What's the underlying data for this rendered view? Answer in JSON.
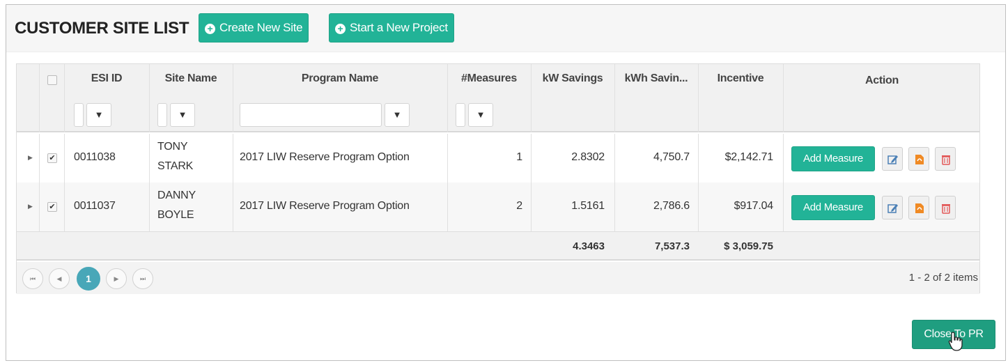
{
  "header": {
    "title": "CUSTOMER SITE LIST",
    "create_site_label": "Create New Site",
    "start_project_label": "Start a New Project"
  },
  "grid": {
    "columns": {
      "esi_id": "ESI ID",
      "site_name": "Site Name",
      "program_name": "Program Name",
      "measures": "#Measures",
      "kw_savings": "kW Savings",
      "kwh_savings": "kWh Savin...",
      "incentive": "Incentive",
      "action": "Action"
    },
    "rows": [
      {
        "checked": true,
        "esi_id": "0011038",
        "site_name_line1": "TONY",
        "site_name_line2": "STARK",
        "program_name": "2017 LIW Reserve Program Option",
        "measures": "1",
        "kw_savings": "2.8302",
        "kwh_savings": "4,750.7",
        "incentive": "$2,142.71",
        "add_measure_label": "Add Measure"
      },
      {
        "checked": true,
        "esi_id": "0011037",
        "site_name_line1": "DANNY",
        "site_name_line2": "BOYLE",
        "program_name": "2017 LIW Reserve Program Option",
        "measures": "2",
        "kw_savings": "1.5161",
        "kwh_savings": "2,786.6",
        "incentive": "$917.04",
        "add_measure_label": "Add Measure"
      }
    ],
    "totals": {
      "kw_savings": "4.3463",
      "kwh_savings": "7,537.3",
      "incentive": "$ 3,059.75"
    },
    "pager": {
      "current_page": "1",
      "info": "1 - 2 of 2 items"
    }
  },
  "footer": {
    "close_label": "Close To PR"
  },
  "colors": {
    "accent": "#22b397",
    "pager_active": "#48a7b8"
  },
  "icons": [
    "plus-circle-icon",
    "filter-icon",
    "edit-icon",
    "pdf-icon",
    "trash-icon",
    "expand-arrow-icon",
    "hand-cursor-icon"
  ]
}
